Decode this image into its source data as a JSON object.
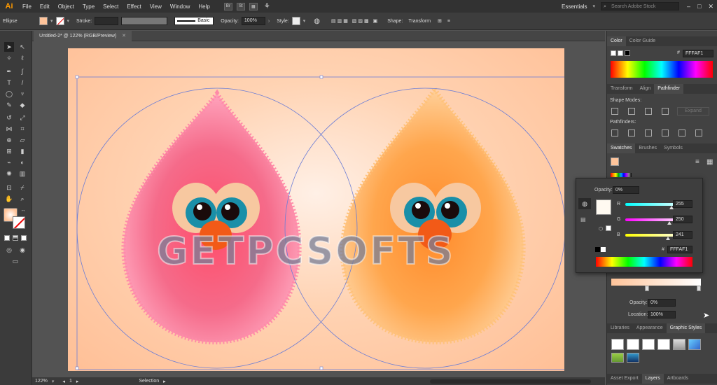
{
  "app": {
    "logo": "Ai"
  },
  "menu": [
    "File",
    "Edit",
    "Object",
    "Type",
    "Select",
    "Effect",
    "View",
    "Window",
    "Help"
  ],
  "menubar_icons": [
    "Br",
    "St"
  ],
  "workspace": "Essentials",
  "search": {
    "placeholder": "Search Adobe Stock"
  },
  "control": {
    "object_type": "Ellipse",
    "stroke_label": "Stroke:",
    "brush_label": "Basic",
    "opacity_label": "Opacity:",
    "opacity_value": "100%",
    "style_label": "Style:",
    "shape_label": "Shape:",
    "transform_label": "Transform"
  },
  "document": {
    "tab_title": "Untitled-2* @ 122% (RGB/Preview)"
  },
  "status": {
    "zoom": "122%",
    "page": "1",
    "tool": "Selection"
  },
  "watermark": "GETPCSOFTS",
  "panels": {
    "color": {
      "tabs": [
        "Color",
        "Color Guide"
      ],
      "hex_label": "#",
      "hex": "FFFAF1"
    },
    "pathfinder": {
      "tabs": [
        "Transform",
        "Align",
        "Pathfinder"
      ],
      "shape_modes": "Shape Modes:",
      "expand": "Expand",
      "pathfinders": "Pathfinders:"
    },
    "swatches": {
      "tabs": [
        "Swatches",
        "Brushes",
        "Symbols"
      ]
    },
    "gradient": {
      "opacity_label": "Opacity:",
      "opacity_value": "0%",
      "location_label": "Location:",
      "location_value": "100%"
    },
    "styles": {
      "tabs": [
        "Libraries",
        "Appearance",
        "Graphic Styles"
      ]
    },
    "bottom": {
      "tabs": [
        "Asset Export",
        "Layers",
        "Artboards"
      ]
    }
  },
  "popup": {
    "opacity_label": "Opacity:",
    "opacity_value": "0%",
    "r_label": "R",
    "r_value": "255",
    "g_label": "G",
    "g_value": "250",
    "b_label": "B",
    "b_value": "241",
    "hex_label": "#",
    "hex": "FFFAF1"
  },
  "colors": {
    "accent": "#ff9a00",
    "pink_bird": "#f06a86",
    "orange_bird": "#ffa64d",
    "eye": "#1a8fa8"
  }
}
